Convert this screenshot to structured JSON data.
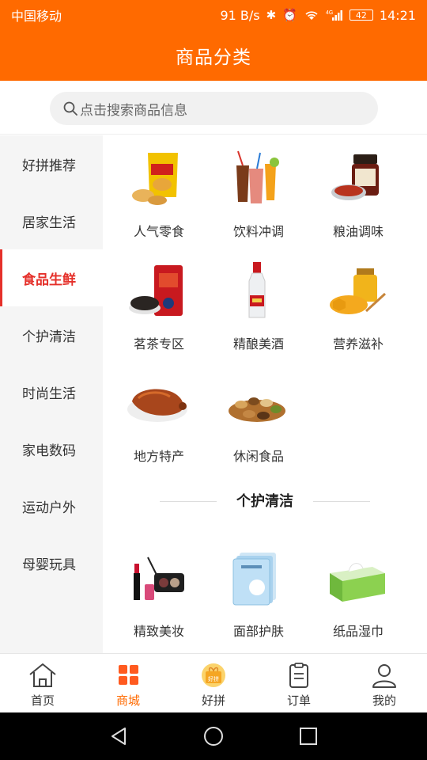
{
  "status_bar": {
    "carrier": "中国移动",
    "net_speed": "91 B/s",
    "signal_label": "4G",
    "battery": "42",
    "time": "14:21"
  },
  "header": {
    "title": "商品分类"
  },
  "search": {
    "placeholder": "点击搜索商品信息"
  },
  "left_nav": {
    "items": [
      {
        "label": "好拼推荐"
      },
      {
        "label": "居家生活"
      },
      {
        "label": "食品生鲜"
      },
      {
        "label": "个护清洁"
      },
      {
        "label": "时尚生活"
      },
      {
        "label": "家电数码"
      },
      {
        "label": "运动户外"
      },
      {
        "label": "母婴玩具"
      }
    ],
    "active": "食品生鲜"
  },
  "content": {
    "food_items": [
      {
        "label": "人气零食",
        "icon": "chips-bag-icon"
      },
      {
        "label": "饮料冲调",
        "icon": "drinks-icon"
      },
      {
        "label": "粮油调味",
        "icon": "sauce-jar-icon"
      },
      {
        "label": "茗茶专区",
        "icon": "tea-can-icon"
      },
      {
        "label": "精酿美酒",
        "icon": "liquor-bottle-icon"
      },
      {
        "label": "营养滋补",
        "icon": "honey-icon"
      },
      {
        "label": "地方特产",
        "icon": "roast-duck-icon"
      },
      {
        "label": "休闲食品",
        "icon": "mixed-nuts-icon"
      }
    ],
    "section_title": "个护清洁",
    "care_items": [
      {
        "label": "精致美妆",
        "icon": "makeup-icon"
      },
      {
        "label": "面部护肤",
        "icon": "face-mask-icon"
      },
      {
        "label": "纸品湿巾",
        "icon": "tissue-box-icon"
      }
    ]
  },
  "tab_bar": {
    "tabs": [
      {
        "label": "首页",
        "icon": "home-icon"
      },
      {
        "label": "商城",
        "icon": "grid-icon"
      },
      {
        "label": "好拼",
        "icon": "gift-icon",
        "badge": "好拼"
      },
      {
        "label": "订单",
        "icon": "clipboard-icon"
      },
      {
        "label": "我的",
        "icon": "user-icon"
      }
    ],
    "active": "商城"
  },
  "colors": {
    "brand_orange": "#ff6a00",
    "active_red": "#e5302a",
    "nav_bg": "#f5f5f5"
  }
}
